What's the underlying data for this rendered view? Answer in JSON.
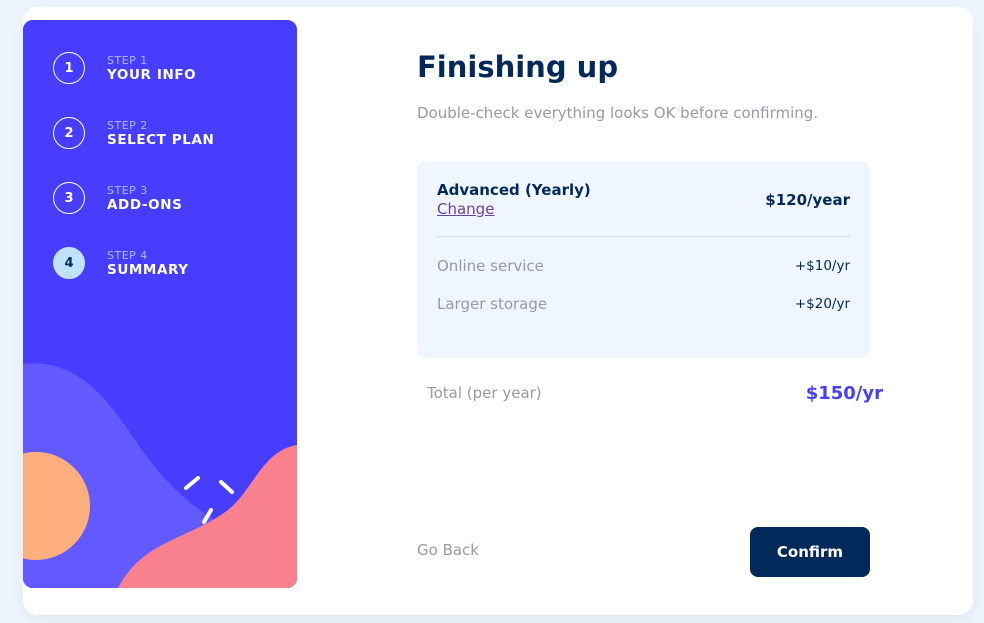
{
  "steps": [
    {
      "number": "1",
      "label": "STEP 1",
      "title": "YOUR INFO",
      "active": false
    },
    {
      "number": "2",
      "label": "STEP 2",
      "title": "SELECT PLAN",
      "active": false
    },
    {
      "number": "3",
      "label": "STEP 3",
      "title": "ADD-ONS",
      "active": false
    },
    {
      "number": "4",
      "label": "STEP 4",
      "title": "SUMMARY",
      "active": true
    }
  ],
  "main": {
    "title": "Finishing up",
    "subtitle": "Double-check everything looks OK before confirming."
  },
  "summary": {
    "plan_name": "Advanced (Yearly)",
    "change_label": "Change",
    "plan_price": "$120/year",
    "addons": [
      {
        "name": "Online service",
        "price": "+$10/yr"
      },
      {
        "name": "Larger storage",
        "price": "+$20/yr"
      }
    ]
  },
  "total": {
    "label": "Total (per year)",
    "value": "$150/yr"
  },
  "actions": {
    "back_label": "Go Back",
    "confirm_label": "Confirm"
  },
  "colors": {
    "sidebar_bg": "#473dff",
    "marine_blue": "#02295a",
    "purplish_blue": "#473dff",
    "cool_gray": "#9699ab",
    "light_blue": "#bfe2fd",
    "summary_bg": "#f0f6ff"
  }
}
